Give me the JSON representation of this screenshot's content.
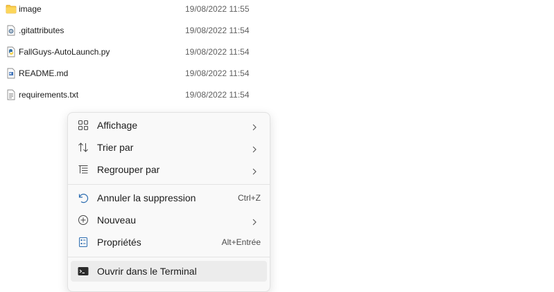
{
  "files": [
    {
      "name": "image",
      "date": "19/08/2022 11:55",
      "icon": "folder-icon"
    },
    {
      "name": ".gitattributes",
      "date": "19/08/2022 11:54",
      "icon": "settings-file-icon"
    },
    {
      "name": "FallGuys-AutoLaunch.py",
      "date": "19/08/2022 11:54",
      "icon": "python-file-icon"
    },
    {
      "name": "README.md",
      "date": "19/08/2022 11:54",
      "icon": "markdown-file-icon"
    },
    {
      "name": "requirements.txt",
      "date": "19/08/2022 11:54",
      "icon": "text-file-icon"
    }
  ],
  "context_menu": {
    "items": [
      {
        "label": "Affichage",
        "icon": "grid-view-icon",
        "submenu": true
      },
      {
        "label": "Trier par",
        "icon": "sort-icon",
        "submenu": true
      },
      {
        "label": "Regrouper par",
        "icon": "group-list-icon",
        "submenu": true
      },
      {
        "label": "Annuler la suppression",
        "icon": "undo-icon",
        "shortcut": "Ctrl+Z"
      },
      {
        "label": "Nouveau",
        "icon": "new-plus-icon",
        "submenu": true
      },
      {
        "label": "Propriétés",
        "icon": "properties-icon",
        "shortcut": "Alt+Entrée"
      },
      {
        "label": "Ouvrir dans le Terminal",
        "icon": "terminal-icon",
        "highlighted": true
      }
    ]
  },
  "colors": {
    "folder": "#f6c744",
    "python_blue": "#3772a4",
    "python_yellow": "#f5d142",
    "menu_bg": "#f9f9f9",
    "highlight_bg": "#ececec"
  }
}
